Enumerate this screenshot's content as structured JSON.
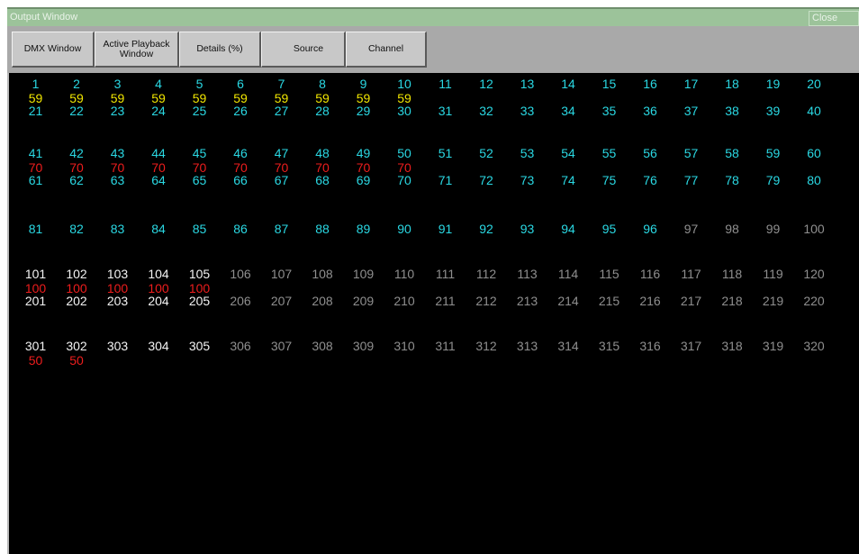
{
  "window": {
    "title": "Output Window",
    "close_label": "Close"
  },
  "toolbar": {
    "dmx_label": "DMX Window",
    "active_playback_label": "Active Playback\nWindow",
    "details_label": "Details (%)",
    "source_label": "Source",
    "channel_label": "Channel"
  },
  "colors": {
    "cyan": "#2ad8e3",
    "white": "#f4f4f4",
    "gray": "#8f8f8f",
    "yellow": "#f1e600",
    "red": "#ee1d1d"
  },
  "channels": [
    {
      "ch": "1",
      "c": "cyan",
      "v": "59",
      "vc": "yellow"
    },
    {
      "ch": "2",
      "c": "cyan",
      "v": "59",
      "vc": "yellow"
    },
    {
      "ch": "3",
      "c": "cyan",
      "v": "59",
      "vc": "yellow"
    },
    {
      "ch": "4",
      "c": "cyan",
      "v": "59",
      "vc": "yellow"
    },
    {
      "ch": "5",
      "c": "cyan",
      "v": "59",
      "vc": "yellow"
    },
    {
      "ch": "6",
      "c": "cyan",
      "v": "59",
      "vc": "yellow"
    },
    {
      "ch": "7",
      "c": "cyan",
      "v": "59",
      "vc": "yellow"
    },
    {
      "ch": "8",
      "c": "cyan",
      "v": "59",
      "vc": "yellow"
    },
    {
      "ch": "9",
      "c": "cyan",
      "v": "59",
      "vc": "yellow"
    },
    {
      "ch": "10",
      "c": "cyan",
      "v": "59",
      "vc": "yellow"
    },
    {
      "ch": "11",
      "c": "cyan"
    },
    {
      "ch": "12",
      "c": "cyan"
    },
    {
      "ch": "13",
      "c": "cyan"
    },
    {
      "ch": "14",
      "c": "cyan"
    },
    {
      "ch": "15",
      "c": "cyan"
    },
    {
      "ch": "16",
      "c": "cyan"
    },
    {
      "ch": "17",
      "c": "cyan"
    },
    {
      "ch": "18",
      "c": "cyan"
    },
    {
      "ch": "19",
      "c": "cyan"
    },
    {
      "ch": "20",
      "c": "cyan"
    },
    {
      "ch": "21",
      "c": "cyan"
    },
    {
      "ch": "22",
      "c": "cyan"
    },
    {
      "ch": "23",
      "c": "cyan"
    },
    {
      "ch": "24",
      "c": "cyan"
    },
    {
      "ch": "25",
      "c": "cyan"
    },
    {
      "ch": "26",
      "c": "cyan"
    },
    {
      "ch": "27",
      "c": "cyan"
    },
    {
      "ch": "28",
      "c": "cyan"
    },
    {
      "ch": "29",
      "c": "cyan"
    },
    {
      "ch": "30",
      "c": "cyan"
    },
    {
      "ch": "31",
      "c": "cyan"
    },
    {
      "ch": "32",
      "c": "cyan"
    },
    {
      "ch": "33",
      "c": "cyan"
    },
    {
      "ch": "34",
      "c": "cyan"
    },
    {
      "ch": "35",
      "c": "cyan"
    },
    {
      "ch": "36",
      "c": "cyan"
    },
    {
      "ch": "37",
      "c": "cyan"
    },
    {
      "ch": "38",
      "c": "cyan"
    },
    {
      "ch": "39",
      "c": "cyan"
    },
    {
      "ch": "40",
      "c": "cyan"
    },
    {
      "ch": "41",
      "c": "cyan",
      "v": "70",
      "vc": "red"
    },
    {
      "ch": "42",
      "c": "cyan",
      "v": "70",
      "vc": "red"
    },
    {
      "ch": "43",
      "c": "cyan",
      "v": "70",
      "vc": "red"
    },
    {
      "ch": "44",
      "c": "cyan",
      "v": "70",
      "vc": "red"
    },
    {
      "ch": "45",
      "c": "cyan",
      "v": "70",
      "vc": "red"
    },
    {
      "ch": "46",
      "c": "cyan",
      "v": "70",
      "vc": "red"
    },
    {
      "ch": "47",
      "c": "cyan",
      "v": "70",
      "vc": "red"
    },
    {
      "ch": "48",
      "c": "cyan",
      "v": "70",
      "vc": "red"
    },
    {
      "ch": "49",
      "c": "cyan",
      "v": "70",
      "vc": "red"
    },
    {
      "ch": "50",
      "c": "cyan",
      "v": "70",
      "vc": "red"
    },
    {
      "ch": "51",
      "c": "cyan"
    },
    {
      "ch": "52",
      "c": "cyan"
    },
    {
      "ch": "53",
      "c": "cyan"
    },
    {
      "ch": "54",
      "c": "cyan"
    },
    {
      "ch": "55",
      "c": "cyan"
    },
    {
      "ch": "56",
      "c": "cyan"
    },
    {
      "ch": "57",
      "c": "cyan"
    },
    {
      "ch": "58",
      "c": "cyan"
    },
    {
      "ch": "59",
      "c": "cyan"
    },
    {
      "ch": "60",
      "c": "cyan"
    },
    {
      "ch": "61",
      "c": "cyan"
    },
    {
      "ch": "62",
      "c": "cyan"
    },
    {
      "ch": "63",
      "c": "cyan"
    },
    {
      "ch": "64",
      "c": "cyan"
    },
    {
      "ch": "65",
      "c": "cyan"
    },
    {
      "ch": "66",
      "c": "cyan"
    },
    {
      "ch": "67",
      "c": "cyan"
    },
    {
      "ch": "68",
      "c": "cyan"
    },
    {
      "ch": "69",
      "c": "cyan"
    },
    {
      "ch": "70",
      "c": "cyan"
    },
    {
      "ch": "71",
      "c": "cyan"
    },
    {
      "ch": "72",
      "c": "cyan"
    },
    {
      "ch": "73",
      "c": "cyan"
    },
    {
      "ch": "74",
      "c": "cyan"
    },
    {
      "ch": "75",
      "c": "cyan"
    },
    {
      "ch": "76",
      "c": "cyan"
    },
    {
      "ch": "77",
      "c": "cyan"
    },
    {
      "ch": "78",
      "c": "cyan"
    },
    {
      "ch": "79",
      "c": "cyan"
    },
    {
      "ch": "80",
      "c": "cyan"
    },
    {
      "ch": "81",
      "c": "cyan"
    },
    {
      "ch": "82",
      "c": "cyan"
    },
    {
      "ch": "83",
      "c": "cyan"
    },
    {
      "ch": "84",
      "c": "cyan"
    },
    {
      "ch": "85",
      "c": "cyan"
    },
    {
      "ch": "86",
      "c": "cyan"
    },
    {
      "ch": "87",
      "c": "cyan"
    },
    {
      "ch": "88",
      "c": "cyan"
    },
    {
      "ch": "89",
      "c": "cyan"
    },
    {
      "ch": "90",
      "c": "cyan"
    },
    {
      "ch": "91",
      "c": "cyan"
    },
    {
      "ch": "92",
      "c": "cyan"
    },
    {
      "ch": "93",
      "c": "cyan"
    },
    {
      "ch": "94",
      "c": "cyan"
    },
    {
      "ch": "95",
      "c": "cyan"
    },
    {
      "ch": "96",
      "c": "cyan"
    },
    {
      "ch": "97",
      "c": "gray"
    },
    {
      "ch": "98",
      "c": "gray"
    },
    {
      "ch": "99",
      "c": "gray"
    },
    {
      "ch": "100",
      "c": "gray"
    },
    {
      "ch": "101",
      "c": "white",
      "v": "100",
      "vc": "red"
    },
    {
      "ch": "102",
      "c": "white",
      "v": "100",
      "vc": "red"
    },
    {
      "ch": "103",
      "c": "white",
      "v": "100",
      "vc": "red"
    },
    {
      "ch": "104",
      "c": "white",
      "v": "100",
      "vc": "red"
    },
    {
      "ch": "105",
      "c": "white",
      "v": "100",
      "vc": "red"
    },
    {
      "ch": "106",
      "c": "gray"
    },
    {
      "ch": "107",
      "c": "gray"
    },
    {
      "ch": "108",
      "c": "gray"
    },
    {
      "ch": "109",
      "c": "gray"
    },
    {
      "ch": "110",
      "c": "gray"
    },
    {
      "ch": "111",
      "c": "gray"
    },
    {
      "ch": "112",
      "c": "gray"
    },
    {
      "ch": "113",
      "c": "gray"
    },
    {
      "ch": "114",
      "c": "gray"
    },
    {
      "ch": "115",
      "c": "gray"
    },
    {
      "ch": "116",
      "c": "gray"
    },
    {
      "ch": "117",
      "c": "gray"
    },
    {
      "ch": "118",
      "c": "gray"
    },
    {
      "ch": "119",
      "c": "gray"
    },
    {
      "ch": "120",
      "c": "gray"
    },
    {
      "ch": "201",
      "c": "white"
    },
    {
      "ch": "202",
      "c": "white"
    },
    {
      "ch": "203",
      "c": "white"
    },
    {
      "ch": "204",
      "c": "white"
    },
    {
      "ch": "205",
      "c": "white"
    },
    {
      "ch": "206",
      "c": "gray"
    },
    {
      "ch": "207",
      "c": "gray"
    },
    {
      "ch": "208",
      "c": "gray"
    },
    {
      "ch": "209",
      "c": "gray"
    },
    {
      "ch": "210",
      "c": "gray"
    },
    {
      "ch": "211",
      "c": "gray"
    },
    {
      "ch": "212",
      "c": "gray"
    },
    {
      "ch": "213",
      "c": "gray"
    },
    {
      "ch": "214",
      "c": "gray"
    },
    {
      "ch": "215",
      "c": "gray"
    },
    {
      "ch": "216",
      "c": "gray"
    },
    {
      "ch": "217",
      "c": "gray"
    },
    {
      "ch": "218",
      "c": "gray"
    },
    {
      "ch": "219",
      "c": "gray"
    },
    {
      "ch": "220",
      "c": "gray"
    },
    {
      "ch": "301",
      "c": "white",
      "v": "50",
      "vc": "red"
    },
    {
      "ch": "302",
      "c": "white",
      "v": "50",
      "vc": "red"
    },
    {
      "ch": "303",
      "c": "white"
    },
    {
      "ch": "304",
      "c": "white"
    },
    {
      "ch": "305",
      "c": "white"
    },
    {
      "ch": "306",
      "c": "gray"
    },
    {
      "ch": "307",
      "c": "gray"
    },
    {
      "ch": "308",
      "c": "gray"
    },
    {
      "ch": "309",
      "c": "gray"
    },
    {
      "ch": "310",
      "c": "gray"
    },
    {
      "ch": "311",
      "c": "gray"
    },
    {
      "ch": "312",
      "c": "gray"
    },
    {
      "ch": "313",
      "c": "gray"
    },
    {
      "ch": "314",
      "c": "gray"
    },
    {
      "ch": "315",
      "c": "gray"
    },
    {
      "ch": "316",
      "c": "gray"
    },
    {
      "ch": "317",
      "c": "gray"
    },
    {
      "ch": "318",
      "c": "gray"
    },
    {
      "ch": "319",
      "c": "gray"
    },
    {
      "ch": "320",
      "c": "gray"
    }
  ]
}
